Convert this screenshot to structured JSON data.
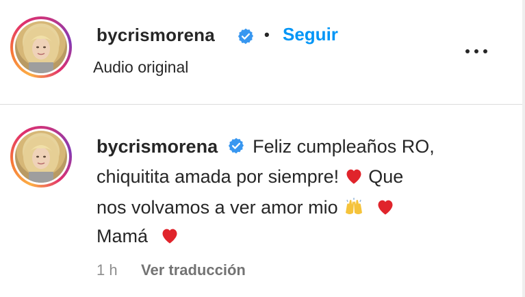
{
  "post": {
    "username": "bycrismorena",
    "follow_label": "Seguir",
    "separator": "•",
    "audio_label": "Audio original"
  },
  "caption": {
    "username": "bycrismorena",
    "line1": "Feliz cumpleaños RO,",
    "line2": "chiquitita amada por siempre!",
    "line2_after_heart": "Que",
    "line3": "nos volvamos a ver amor mio",
    "line4": "Mamá",
    "time": "1 h",
    "translate_label": "Ver traducción"
  },
  "colors": {
    "accent": "#0095f6",
    "verified": "#3897f0",
    "heart": "#e0242b",
    "text": "#262626",
    "muted": "#8e8e8e"
  },
  "icons": {
    "verified": "verified-badge-icon",
    "more": "more-options-icon",
    "heart": "red-heart-emoji",
    "hands": "raised-hands-emoji"
  }
}
